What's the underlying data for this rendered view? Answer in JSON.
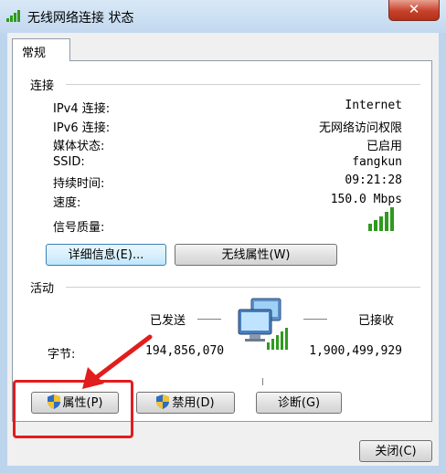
{
  "window": {
    "title": "无线网络连接 状态",
    "close_glyph": "✕"
  },
  "tab": {
    "label": "常规"
  },
  "connection": {
    "heading": "连接",
    "rows": [
      {
        "label": "IPv4 连接:",
        "value": "Internet"
      },
      {
        "label": "IPv6 连接:",
        "value": "无网络访问权限"
      },
      {
        "label": "媒体状态:",
        "value": "已启用"
      },
      {
        "label": "SSID:",
        "value": "fangkun"
      },
      {
        "label": "持续时间:",
        "value": "09:21:28"
      },
      {
        "label": "速度:",
        "value": "150.0 Mbps"
      }
    ],
    "signal_label": "信号质量:",
    "signal_bars": 5,
    "details_button": "详细信息(E)...",
    "wireless_props_button": "无线属性(W)"
  },
  "activity": {
    "heading": "活动",
    "sent_label": "已发送",
    "received_label": "已接收",
    "bytes_label": "字节:",
    "bytes_sent": "194,856,070",
    "bytes_received": "1,900,499,929"
  },
  "actions": {
    "properties_button": "属性(P)",
    "disable_button": "禁用(D)",
    "diagnose_button": "诊断(G)"
  },
  "footer": {
    "close_button": "关闭(C)"
  },
  "colors": {
    "highlight_box": "#e21d1d",
    "arrow": "#e21d1d",
    "signal": "#2f9a1e"
  }
}
